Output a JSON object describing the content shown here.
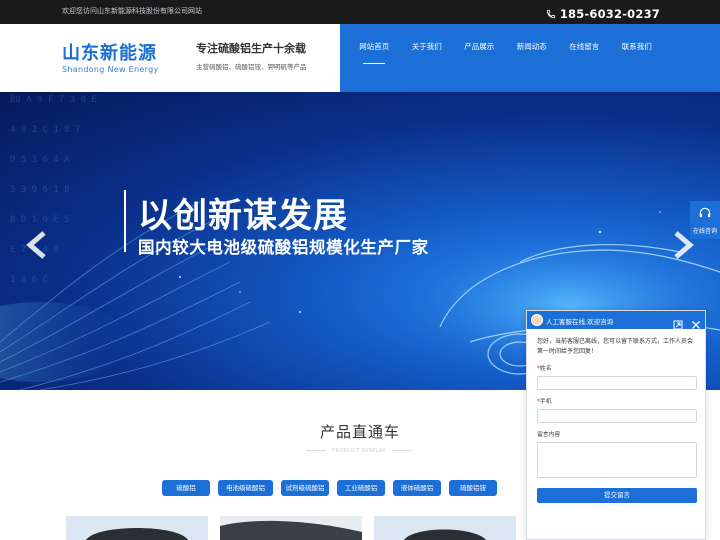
{
  "topbar": {
    "welcome": "欢迎您访问山东新能源科技股份有限公司网站",
    "phone": "185-6032-0237",
    "phone_icon": "phone-icon"
  },
  "header": {
    "logo_cn": "山东新能源",
    "logo_en": "Shandong New Energy",
    "slogan_title": "专注硫酸铝生产十余载",
    "slogan_sub": "主营硫酸铝、硫酸铝铵、钾明矾等产品"
  },
  "nav": {
    "items": [
      {
        "label": "网站首页"
      },
      {
        "label": "关于我们"
      },
      {
        "label": "产品展示"
      },
      {
        "label": "新闻动态"
      },
      {
        "label": "在线留言"
      },
      {
        "label": "联系我们"
      }
    ],
    "active_index": 0
  },
  "banner": {
    "title": "以创新谋发展",
    "subtitle": "国内较大电池级硫酸铝规模化生产厂家",
    "prev_icon": "chevron-left-icon",
    "next_icon": "chevron-right-icon"
  },
  "side_tab": {
    "label": "在线咨询",
    "icon": "headset-icon"
  },
  "products": {
    "title": "产品直通车",
    "subtitle": "PRODUCT DISPLAY",
    "categories": [
      "硫酸铝",
      "电池级硫酸铝",
      "试剂级硫酸铝",
      "工业硫酸铝",
      "液体硫酸铝",
      "硫酸铝铵"
    ]
  },
  "chat": {
    "header_title": "人工客服在线,欢迎咨询",
    "notice": "您好，当前客服已离线，您可以留下联系方式，工作人员会第一时间给予您回复！",
    "fields": [
      {
        "label": "姓名",
        "required": true
      },
      {
        "label": "手机",
        "required": true
      },
      {
        "label": "留言内容",
        "required": false
      }
    ],
    "submit_label": "提交留言",
    "minimize_icon": "minimize-icon",
    "close_icon": "close-icon"
  },
  "colors": {
    "brand_blue": "#1b6fd6",
    "topbar_bg": "#1a1a1a",
    "banner_dark": "#061a59"
  }
}
